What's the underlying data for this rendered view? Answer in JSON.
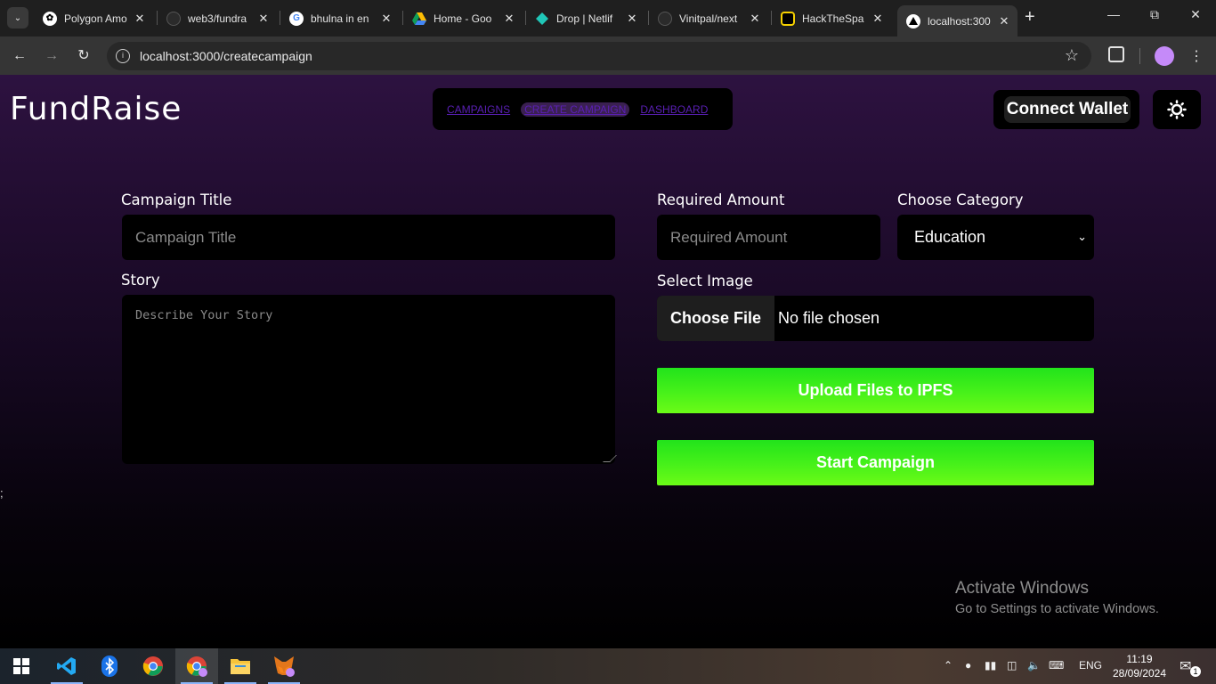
{
  "browser": {
    "tabs": [
      {
        "title": "Polygon Amo",
        "icon": "openai-icon",
        "active": false
      },
      {
        "title": "web3/fundra",
        "icon": "github-icon",
        "active": false
      },
      {
        "title": "bhulna in en",
        "icon": "google-icon",
        "active": false
      },
      {
        "title": "Home - Goo",
        "icon": "google-drive-icon",
        "active": false
      },
      {
        "title": "Drop | Netlif",
        "icon": "netlify-icon",
        "active": false
      },
      {
        "title": "Vinitpal/next",
        "icon": "github-icon",
        "active": false
      },
      {
        "title": "HackTheSpa",
        "icon": "hackthespace-icon",
        "active": false
      },
      {
        "title": "localhost:300",
        "icon": "triangle-icon",
        "active": true
      }
    ],
    "url": "localhost:3000/createcampaign"
  },
  "app": {
    "brand": "FundRaise",
    "nav": {
      "campaigns": "CAMPAIGNS",
      "create_campaign": "CREATE CAMPAIGN",
      "dashboard": "DASHBOARD"
    },
    "connect_wallet": "Connect Wallet",
    "theme_toggle_icon": "sun-icon"
  },
  "form": {
    "title_label": "Campaign Title",
    "title_placeholder": "Campaign Title",
    "amount_label": "Required Amount",
    "amount_placeholder": "Required Amount",
    "category_label": "Choose Category",
    "category_value": "Education",
    "story_label": "Story",
    "story_placeholder": "Describe Your Story",
    "image_label": "Select Image",
    "choose_file": "Choose File",
    "no_file": "No file chosen",
    "upload_button": "Upload Files to IPFS",
    "start_button": "Start Campaign"
  },
  "stray_text": ";",
  "watermark": {
    "line1": "Activate Windows",
    "line2": "Go to Settings to activate Windows."
  },
  "taskbar": {
    "language": "ENG",
    "time": "11:19",
    "date": "28/09/2024",
    "notification_count": "1"
  },
  "colors": {
    "accent_green": "#44f01a",
    "nav_link": "#5a1fb5",
    "bg_top": "#2d1240"
  }
}
